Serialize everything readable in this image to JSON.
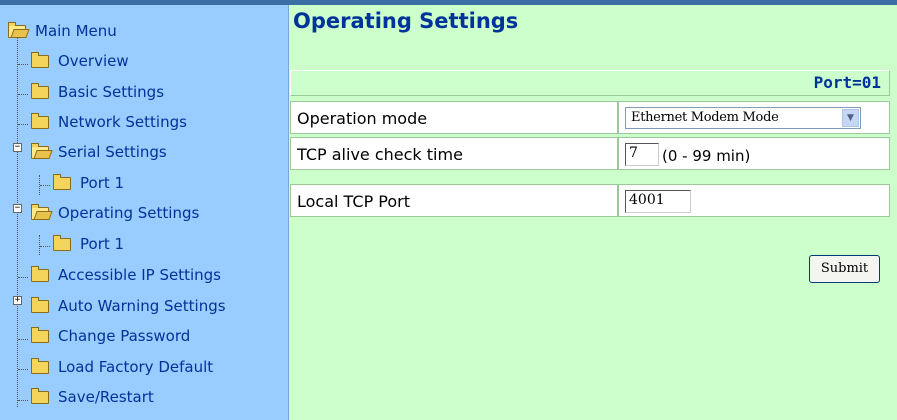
{
  "colors": {
    "sidebar_bg": "#99ccff",
    "content_bg": "#ccffcc",
    "link_text": "#003399",
    "topbar": "#3a6ea5"
  },
  "sidebar": {
    "root": {
      "label": "Main Menu",
      "icon": "open-folder-icon"
    },
    "items": [
      {
        "label": "Overview",
        "icon": "folder-icon"
      },
      {
        "label": "Basic Settings",
        "icon": "folder-icon"
      },
      {
        "label": "Network Settings",
        "icon": "folder-icon"
      },
      {
        "label": "Serial Settings",
        "icon": "open-folder-icon",
        "expanded": true,
        "children": [
          {
            "label": "Port 1",
            "icon": "folder-icon"
          }
        ]
      },
      {
        "label": "Operating Settings",
        "icon": "open-folder-icon",
        "expanded": true,
        "children": [
          {
            "label": "Port 1",
            "icon": "folder-icon"
          }
        ]
      },
      {
        "label": "Accessible IP Settings",
        "icon": "folder-icon"
      },
      {
        "label": "Auto Warning Settings",
        "icon": "folder-icon",
        "expanded": false
      },
      {
        "label": "Change Password",
        "icon": "folder-icon"
      },
      {
        "label": "Load Factory Default",
        "icon": "folder-icon"
      },
      {
        "label": "Save/Restart",
        "icon": "folder-icon"
      }
    ]
  },
  "main": {
    "title": "Operating Settings",
    "port_label": "Port=01",
    "rows": {
      "operation_mode": {
        "label": "Operation mode",
        "value": "Ethernet Modem Mode"
      },
      "tcp_alive": {
        "label": "TCP alive check time",
        "value": "7",
        "hint": "(0 - 99 min)"
      },
      "local_tcp_port": {
        "label": "Local TCP Port",
        "value": "4001"
      }
    },
    "submit_label": "Submit"
  }
}
